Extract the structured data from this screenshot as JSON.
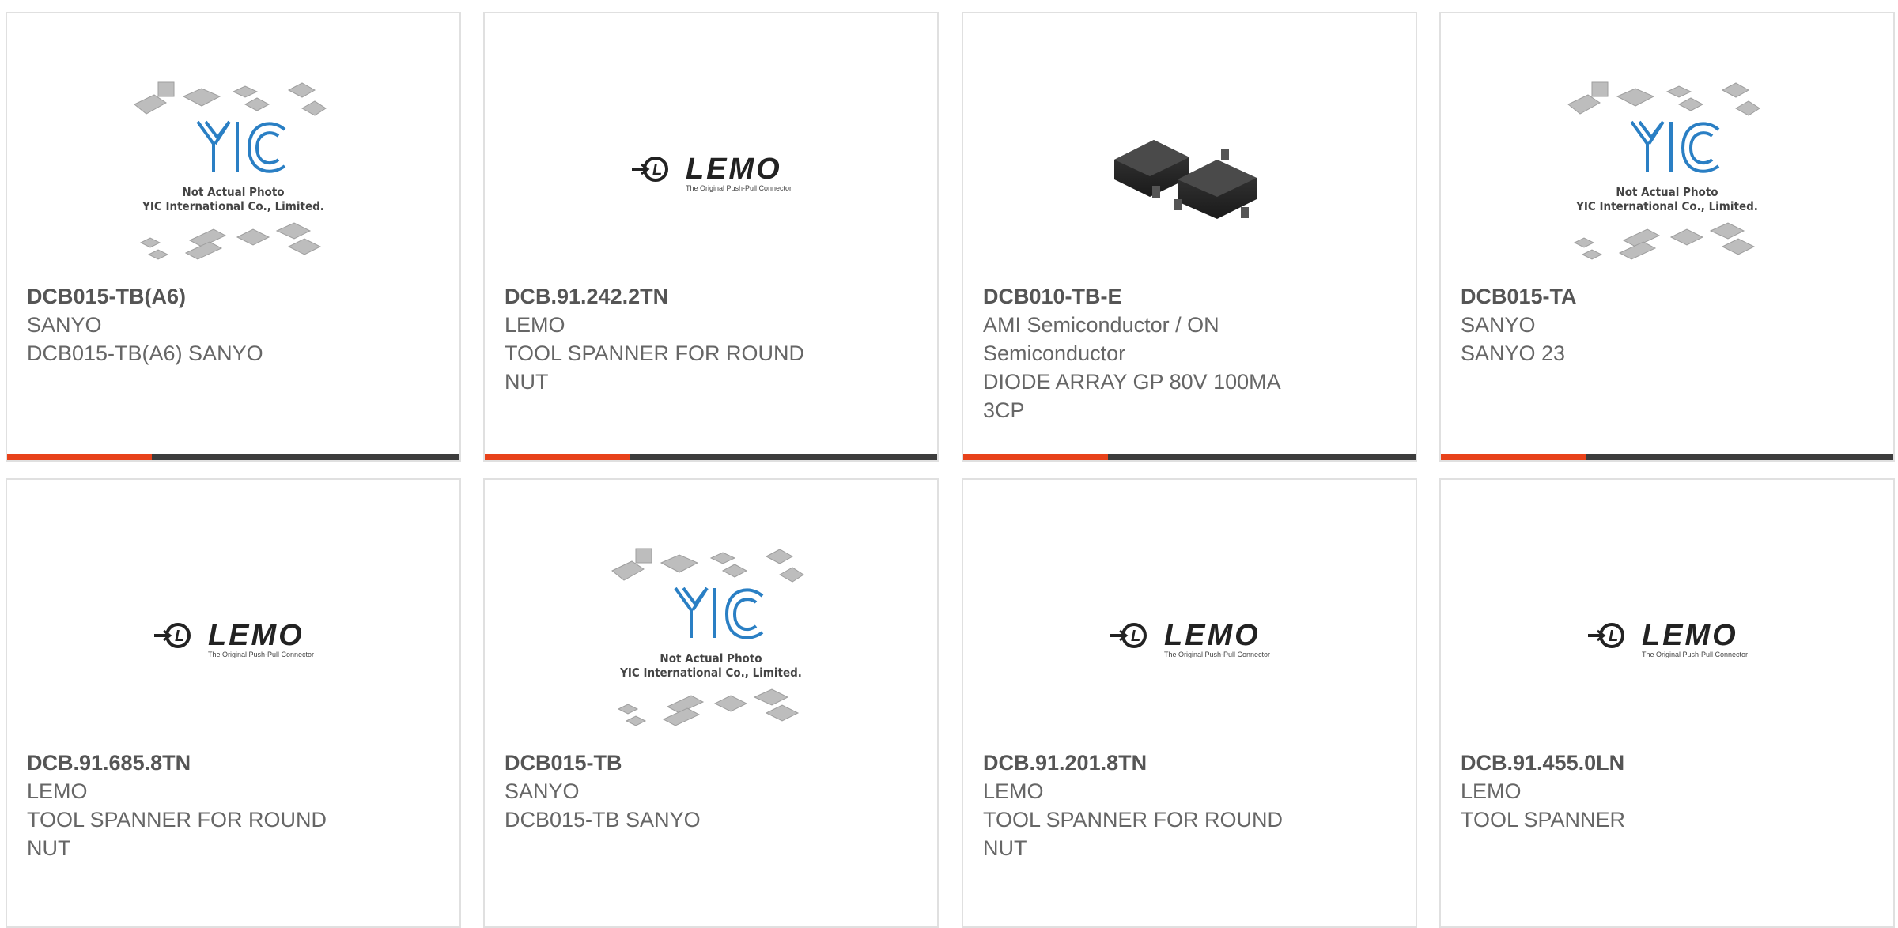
{
  "products": [
    {
      "part_number": "DCB015-TB(A6)",
      "manufacturer": "SANYO",
      "description": "DCB015-TB(A6) SANYO",
      "image": "yic-placeholder",
      "placeholder_caption": [
        "Not Actual Photo",
        "YIC International Co., Limited."
      ]
    },
    {
      "part_number": "DCB.91.242.2TN",
      "manufacturer": "LEMO",
      "description": "TOOL SPANNER FOR ROUND NUT",
      "image": "lemo-logo",
      "logo_text": "LEMO",
      "logo_tagline": "The Original Push-Pull Connector"
    },
    {
      "part_number": "DCB010-TB-E",
      "manufacturer": "AMI Semiconductor / ON Semiconductor",
      "description": "DIODE ARRAY GP 80V 100MA 3CP",
      "image": "sot23-package-photo"
    },
    {
      "part_number": "DCB015-TA",
      "manufacturer": "SANYO",
      "description": "SANYO 23",
      "image": "yic-placeholder",
      "placeholder_caption": [
        "Not Actual Photo",
        "YIC International Co., Limited."
      ]
    },
    {
      "part_number": "DCB.91.685.8TN",
      "manufacturer": "LEMO",
      "description": "TOOL SPANNER FOR ROUND NUT",
      "image": "lemo-logo",
      "logo_text": "LEMO",
      "logo_tagline": "The Original Push-Pull Connector"
    },
    {
      "part_number": "DCB015-TB",
      "manufacturer": "SANYO",
      "description": "DCB015-TB SANYO",
      "image": "yic-placeholder",
      "placeholder_caption": [
        "Not Actual Photo",
        "YIC International Co., Limited."
      ]
    },
    {
      "part_number": "DCB.91.201.8TN",
      "manufacturer": "LEMO",
      "description": "TOOL SPANNER FOR ROUND NUT",
      "image": "lemo-logo",
      "logo_text": "LEMO",
      "logo_tagline": "The Original Push-Pull Connector"
    },
    {
      "part_number": "DCB.91.455.0LN",
      "manufacturer": "LEMO",
      "description": "TOOL SPANNER",
      "image": "lemo-logo",
      "logo_text": "LEMO",
      "logo_tagline": "The Original Push-Pull Connector"
    }
  ],
  "colors": {
    "accent": "#e8421a",
    "bar": "#3c3c3c",
    "text": "#666666",
    "yic_blue": "#2a7fc4"
  }
}
